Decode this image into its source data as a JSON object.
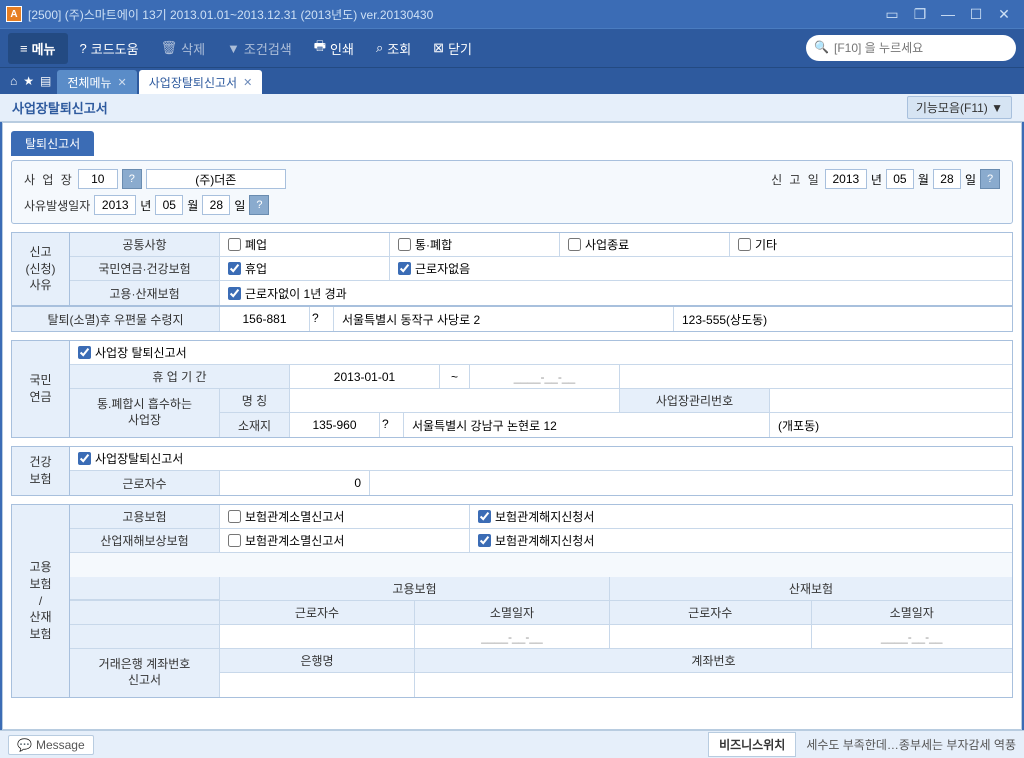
{
  "titlebar": {
    "text": "[2500] (주)스마트에이   13기 2013.01.01~2013.12.31 (2013년도)  ver.20130430"
  },
  "toolbar": {
    "menu": "메뉴",
    "code_help": "코드도움",
    "delete": "삭제",
    "cond_search": "조건검색",
    "print": "인쇄",
    "query": "조회",
    "close": "닫기",
    "search_placeholder": "[F10] 을 누르세요"
  },
  "tabs": {
    "all_menu": "전체메뉴",
    "current": "사업장탈퇴신고서"
  },
  "subheader": {
    "title": "사업장탈퇴신고서",
    "right_btn": "기능모음(F11) ▼"
  },
  "mini_tab": "탈퇴신고서",
  "top_panel": {
    "biz_label": "사  업  장",
    "biz_code": "10",
    "biz_name": "(주)더존",
    "report_label": "신  고  일",
    "report_year": "2013",
    "year_unit": "년",
    "report_month": "05",
    "month_unit": "월",
    "report_day": "28",
    "day_unit": "일",
    "reason_date_label": "사유발생일자",
    "reason_year": "2013",
    "reason_month": "05",
    "reason_day": "28"
  },
  "reason_section": {
    "left_label": "신고\n(신청)\n사유",
    "row1_hdr": "공통사항",
    "row1_opt1": "폐업",
    "row1_opt2": "통·폐합",
    "row1_opt3": "사업종료",
    "row1_opt4": "기타",
    "row2_hdr": "국민연금·건강보험",
    "row2_opt1": "휴업",
    "row2_opt2": "근로자없음",
    "row3_hdr": "고용·산재보험",
    "row3_opt1": "근로자없이 1년 경과"
  },
  "mail_row": {
    "label": "탈퇴(소멸)후 우편물 수령지",
    "zip": "156-881",
    "addr": "서울특별시 동작구 사당로 2",
    "detail": "123-555(상도동)"
  },
  "pension": {
    "left_label": "국민\n연금",
    "chk_label": "사업장 탈퇴신고서",
    "period_label": "휴  업  기  간",
    "period_from": "2013-01-01",
    "period_sep": "~",
    "period_to": "____-__-__",
    "absorb_label": "통.폐합시 흡수하는\n사업장",
    "name_label": "명  칭",
    "mgmt_no_label": "사업장관리번호",
    "loc_label": "소재지",
    "loc_zip": "135-960",
    "loc_addr": "서울특별시 강남구 논현로 12",
    "loc_detail": "(개포동)"
  },
  "health": {
    "left_label": "건강\n보험",
    "chk_label": "사업장탈퇴신고서",
    "worker_label": "근로자수",
    "worker_count": "0"
  },
  "employ": {
    "left_label": "고용\n보험\n/\n산재\n보험",
    "row1_hdr": "고용보험",
    "row1_opt1": "보험관계소멸신고서",
    "row1_opt2": "보험관계해지신청서",
    "row2_hdr": "산업재해보상보험",
    "row2_opt1": "보험관계소멸신고서",
    "row2_opt2": "보험관계해지신청서",
    "col_emp": "고용보험",
    "col_ind": "산재보험",
    "sub_workers": "근로자수",
    "sub_date": "소멸일자",
    "date_placeholder": "____-__-__",
    "bank_label": "거래은행 계좌번호\n신고서",
    "bank_name": "은행명",
    "acct_no": "계좌번호"
  },
  "statusbar": {
    "message": "Message",
    "biz_switch": "비즈니스위치",
    "tip": "세수도 부족한데…종부세는 부자감세 역풍"
  }
}
